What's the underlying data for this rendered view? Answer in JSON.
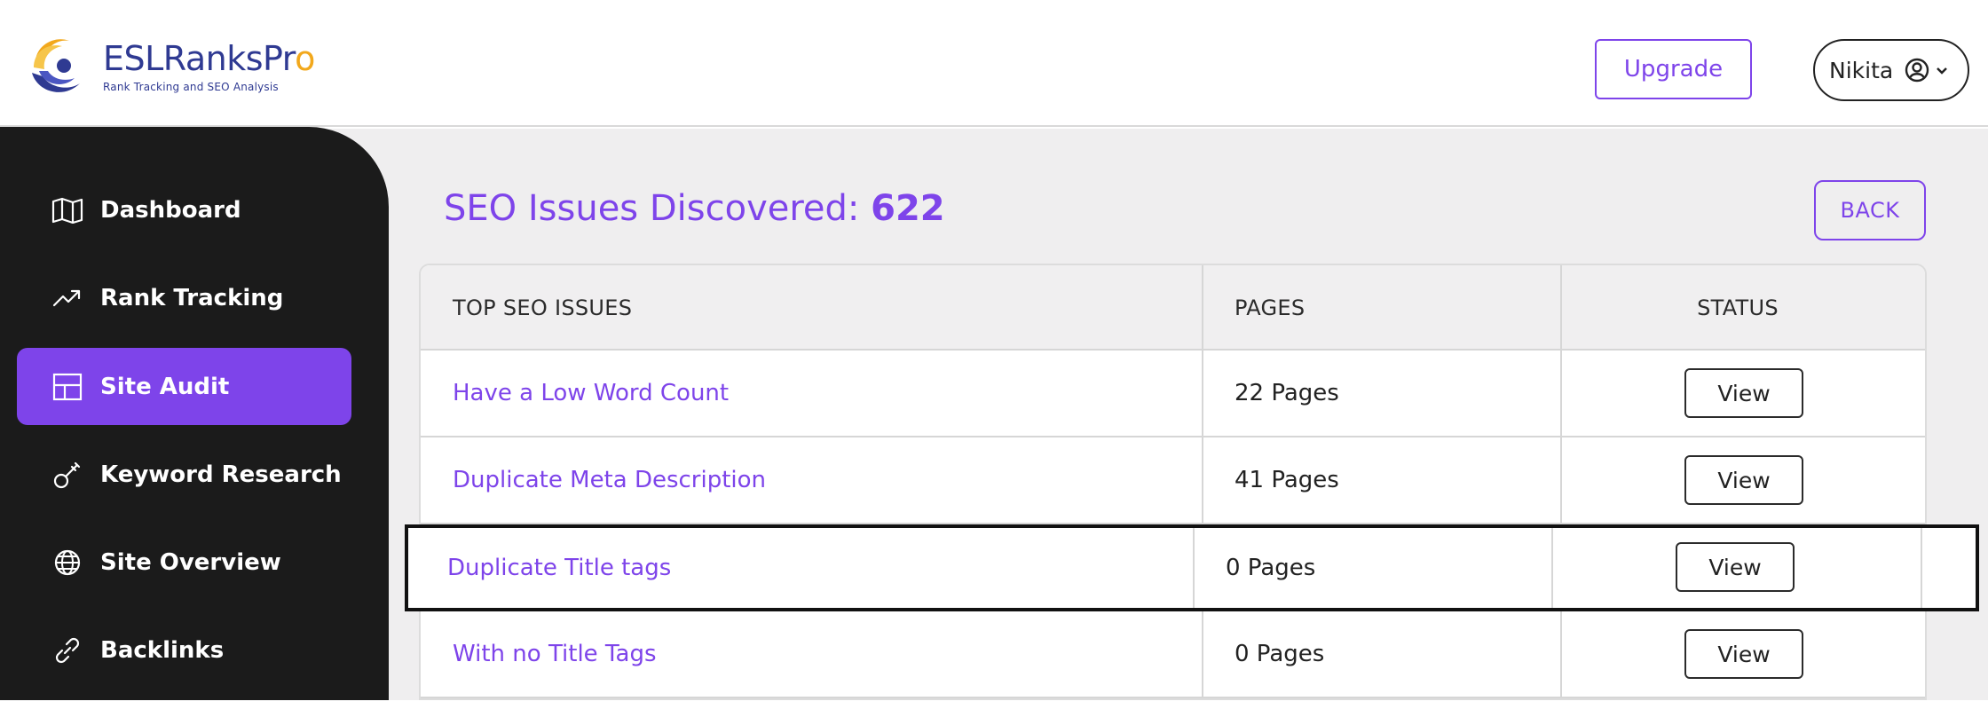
{
  "brand": {
    "name_main": "ESLRanksPr",
    "name_o": "o",
    "tagline": "Rank Tracking and SEO Analysis"
  },
  "header": {
    "upgrade_label": "Upgrade",
    "user_name": "Nikita"
  },
  "sidebar": {
    "items": [
      {
        "label": "Dashboard",
        "icon": "map-icon",
        "active": false
      },
      {
        "label": "Rank Tracking",
        "icon": "trending-up-icon",
        "active": false
      },
      {
        "label": "Site Audit",
        "icon": "layout-icon",
        "active": true
      },
      {
        "label": "Keyword Research",
        "icon": "key-icon",
        "active": false
      },
      {
        "label": "Site Overview",
        "icon": "globe-icon",
        "active": false
      },
      {
        "label": "Backlinks",
        "icon": "link-icon",
        "active": false
      }
    ]
  },
  "main": {
    "title_prefix": "SEO Issues Discovered: ",
    "title_count": "622",
    "back_label": "BACK",
    "table": {
      "headers": [
        "TOP SEO ISSUES",
        "PAGES",
        "STATUS"
      ],
      "rows": [
        {
          "issue": "Have a Low Word Count",
          "pages": "22 Pages",
          "status": "View"
        },
        {
          "issue": "Duplicate Meta Description",
          "pages": "41 Pages",
          "status": "View"
        },
        {
          "issue": "Duplicate Title tags",
          "pages": "0 Pages",
          "status": "View"
        },
        {
          "issue": "With no Title Tags",
          "pages": "0 Pages",
          "status": "View"
        }
      ]
    }
  },
  "colors": {
    "accent": "#7e44ea",
    "sidebar_bg": "#1b1b1b",
    "brand_blue": "#2f3a92",
    "brand_orange": "#f2a81c"
  }
}
